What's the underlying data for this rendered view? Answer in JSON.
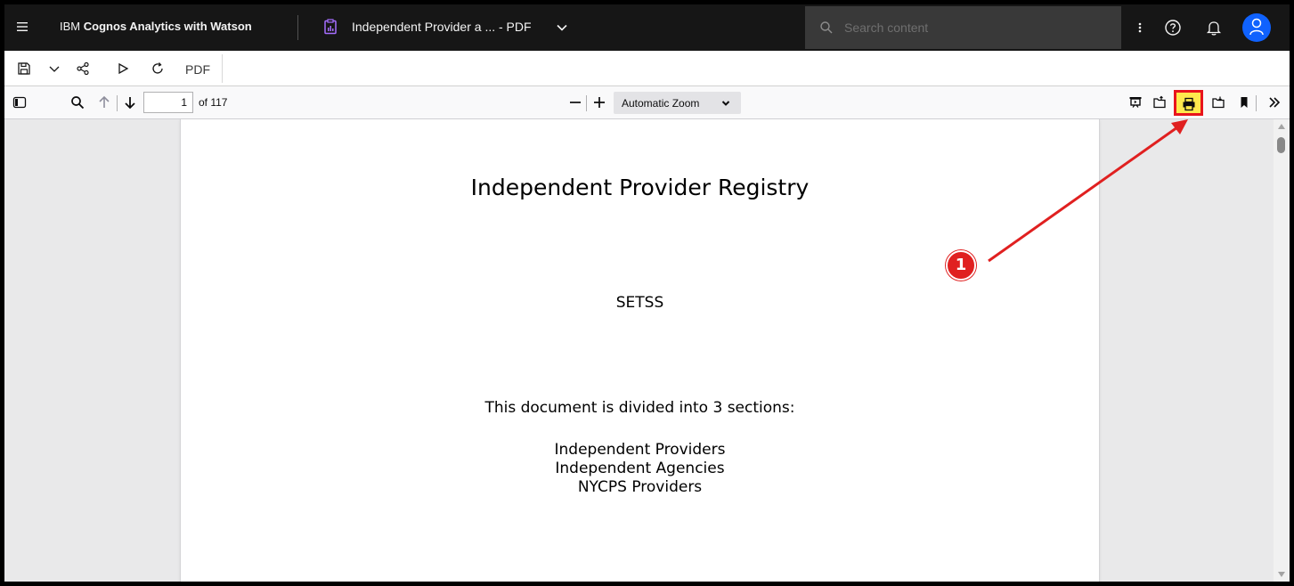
{
  "topbar": {
    "brand_prefix": "IBM ",
    "brand_name": "Cognos Analytics with Watson",
    "document_title": "Independent Provider a ... - PDF",
    "search_placeholder": "Search content",
    "icons": [
      "menu-icon",
      "report-icon",
      "chevron-down-icon",
      "search-icon",
      "overflow-menu-icon",
      "help-icon",
      "notification-icon",
      "user-avatar-icon"
    ]
  },
  "app_toolbar": {
    "output_format": "PDF",
    "icons": [
      "save-icon",
      "chevron-down-icon",
      "share-icon",
      "run-icon",
      "refresh-icon"
    ]
  },
  "pdf_toolbar": {
    "page_number": "1",
    "page_count": "of 117",
    "zoom": "Automatic Zoom",
    "icons": [
      "sidebar-toggle-icon",
      "find-icon",
      "previous-page-icon",
      "next-page-icon",
      "zoom-out-icon",
      "zoom-in-icon",
      "presentation-mode-icon",
      "open-file-icon",
      "print-icon",
      "download-icon",
      "bookmark-icon",
      "tools-icon"
    ]
  },
  "document": {
    "title": "Independent Provider Registry",
    "subtitle": "SETSS",
    "intro": "This document is divided into 3 sections:",
    "sections": [
      "Independent Providers",
      "Independent Agencies",
      "NYCPS Providers"
    ]
  },
  "annotation": {
    "step_number": "1",
    "highlight_color": "#e8141c",
    "target": "print-button"
  },
  "colors": {
    "topbar_bg": "#161616",
    "search_bg": "#393939",
    "avatar": "#0f62fe",
    "viewer_bg": "#e9e9ea",
    "annotation_red": "#e02020",
    "highlight_fill": "#ffe94d"
  }
}
